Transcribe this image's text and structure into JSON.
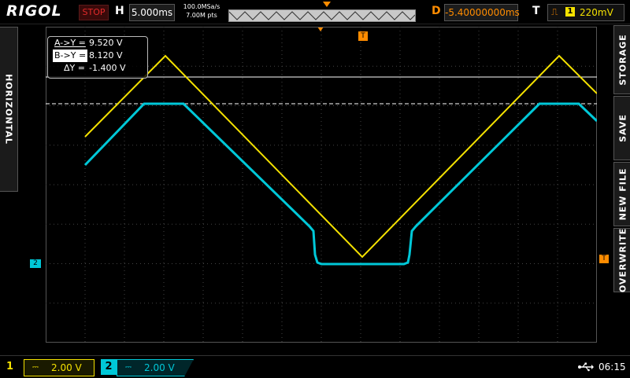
{
  "header": {
    "brand": "RIGOL",
    "run_state": "STOP",
    "horizontal_label": "H",
    "timebase": "5.000ms",
    "sample_rate": "100.0MSa/s",
    "memory_depth": "7.00M pts",
    "delay_label": "D",
    "delay": "-5.40000000ms",
    "trigger_label": "T",
    "trigger_icon": "rising-edge-icon",
    "trigger_source": "1",
    "trigger_level": "220mV"
  },
  "side_tabs": {
    "left": "HORIZONTAL",
    "right": [
      "STORAGE",
      "SAVE",
      "NEW FILE",
      "OVERWRITE"
    ]
  },
  "cursor_readout": {
    "a_label": "A->Y =",
    "a_value": "9.520 V",
    "b_label": "B->Y =",
    "b_value": "8.120 V",
    "delta_label": "ΔY =",
    "delta_value": "-1.400 V"
  },
  "markers": {
    "ch2_offset": "2",
    "trigger": "T"
  },
  "channels": [
    {
      "number": "1",
      "coupling": "⎓",
      "scale": "2.00 V",
      "color": "#f5e200"
    },
    {
      "number": "2",
      "coupling": "⎓",
      "scale": "2.00 V",
      "color": "#00c8d8"
    }
  ],
  "status": {
    "usb_icon": "usb-icon",
    "clock": "06:15"
  },
  "colors": {
    "ch1": "#f5e200",
    "ch2": "#00c8d8",
    "trigger": "#ff8c00",
    "stop": "#e02a2a"
  }
}
